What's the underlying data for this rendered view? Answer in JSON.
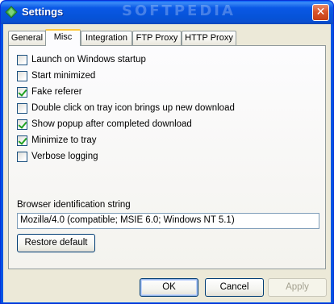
{
  "window": {
    "title": "Settings",
    "watermark": "SOFTPEDIA",
    "close_glyph": "✕"
  },
  "tabs": [
    {
      "label": "General"
    },
    {
      "label": "Misc"
    },
    {
      "label": "Integration"
    },
    {
      "label": "FTP Proxy"
    },
    {
      "label": "HTTP Proxy"
    }
  ],
  "active_tab": "Misc",
  "options": [
    {
      "label": "Launch on Windows startup",
      "checked": false
    },
    {
      "label": "Start minimized",
      "checked": false
    },
    {
      "label": "Fake referer",
      "checked": true
    },
    {
      "label": "Double click on tray icon brings up new download",
      "checked": false
    },
    {
      "label": "Show popup after completed download",
      "checked": true
    },
    {
      "label": "Minimize to tray",
      "checked": true
    },
    {
      "label": "Verbose logging",
      "checked": false
    }
  ],
  "browser_id": {
    "label": "Browser identification string",
    "value": "Mozilla/4.0 (compatible; MSIE 6.0; Windows NT 5.1)"
  },
  "buttons": {
    "restore_default": "Restore default",
    "ok": "OK",
    "cancel": "Cancel",
    "apply": "Apply"
  },
  "icons": {
    "app": "green-gem-icon",
    "close": "close-icon"
  }
}
